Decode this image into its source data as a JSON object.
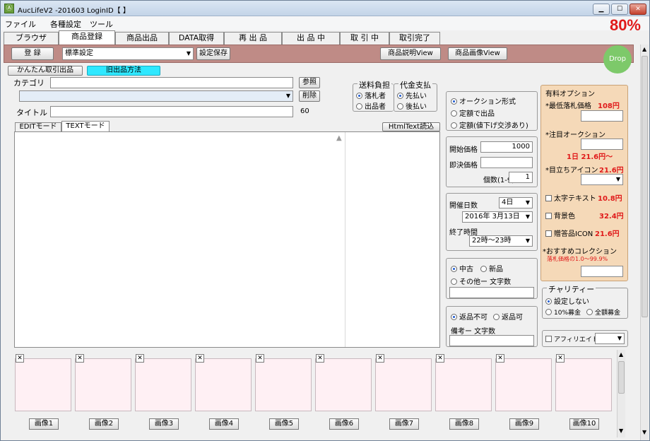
{
  "window": {
    "title": "AucLifeV2 -201603  LoginID【                 】"
  },
  "menu": {
    "items": [
      "ファイル",
      "各種設定",
      "ツール"
    ]
  },
  "zoom": "80%",
  "tabs": [
    "ブラウザ",
    "商品登録",
    "商品出品",
    "DATA取得",
    "再 出 品",
    "出 品 中",
    "取 引 中",
    "取引完了"
  ],
  "toolbar": {
    "register": "登 録",
    "preset": "標準設定",
    "save_setting": "設定保存",
    "desc_view": "商品説明View",
    "image_view": "商品画像View"
  },
  "drop": "Drop",
  "listing": {
    "simple_trade": "かんたん取引出品",
    "old_method": "旧出品方法",
    "category_label": "カテゴリ",
    "browse": "参照",
    "delete": "削除",
    "title_label": "タイトル",
    "title_count": "60",
    "edit_mode": "EDITモード",
    "text_mode": "TEXTモード",
    "html_load": "HtmlText読込"
  },
  "shipping": {
    "label": "送料負担",
    "opt1": "落札者",
    "opt2": "出品者"
  },
  "payment": {
    "label": "代金支払",
    "opt1": "先払い",
    "opt2": "後払い"
  },
  "format": {
    "opt1": "オークション形式",
    "opt2": "定額で出品",
    "opt3": "定額(値下げ交渉あり)"
  },
  "price": {
    "start_label": "開始価格",
    "start_value": "1000",
    "buy_label": "即決価格",
    "qty_label": "個数(1-9)",
    "qty_value": "1"
  },
  "period": {
    "days_label": "開催日数",
    "days_value": "4日",
    "end_date": "2016年 3月13日",
    "end_time_label": "終了時間",
    "end_time": "22時〜23時"
  },
  "condition": {
    "used": "中古",
    "new": "新品",
    "other": "その他ー 文字数"
  },
  "returns": {
    "no": "返品不可",
    "yes": "返品可",
    "note": "備考ー 文字数"
  },
  "options": {
    "title": "有料オプション",
    "min_bid": "*最低落札価格",
    "min_bid_price": "108円",
    "featured": "*注目オークション",
    "featured_price": "1日 21.6円〜",
    "icon": "*目立ちアイコン",
    "icon_price": "21.6円",
    "bold": "太字テキスト",
    "bold_price": "10.8円",
    "bg": "背景色",
    "bg_price": "32.4円",
    "gift": "贈答品ICON",
    "gift_price": "21.6円",
    "recommend": "*おすすめコレクション",
    "recommend_note": "落札価格の1.0〜99.9%"
  },
  "charity": {
    "title": "チャリティー",
    "none": "設定しない",
    "ten": "10%募金",
    "all": "全額募金"
  },
  "affiliate": "アフィリエイト",
  "images": [
    "画像1",
    "画像2",
    "画像3",
    "画像4",
    "画像5",
    "画像6",
    "画像7",
    "画像8",
    "画像9",
    "画像10"
  ]
}
